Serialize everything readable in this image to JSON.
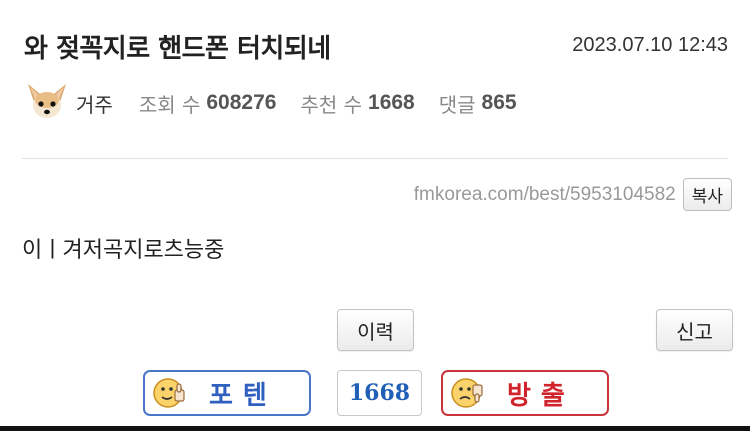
{
  "post": {
    "title": "와 젖꼭지로 핸드폰 터치되네",
    "date": "2023.07.10 12:43",
    "author": "거주",
    "avatar_icon": "chihuahua-avatar",
    "views_label": "조회 수",
    "views": "608276",
    "recommend_label": "추천 수",
    "recommend": "1668",
    "comments_label": "댓글",
    "comments": "865",
    "url": "fmkorea.com/best/5953104582",
    "copy_label": "복사",
    "body": "이ㅣ겨저곡지로츠능중"
  },
  "actions": {
    "history_label": "이력",
    "report_label": "신고"
  },
  "vote": {
    "up_label": "포텐",
    "count": "1668",
    "down_label": "방출",
    "up_color": "#2f5fbf",
    "down_color": "#d1232b",
    "up_icon": "thumbs-up-face-icon",
    "down_icon": "thumbs-down-face-icon"
  }
}
